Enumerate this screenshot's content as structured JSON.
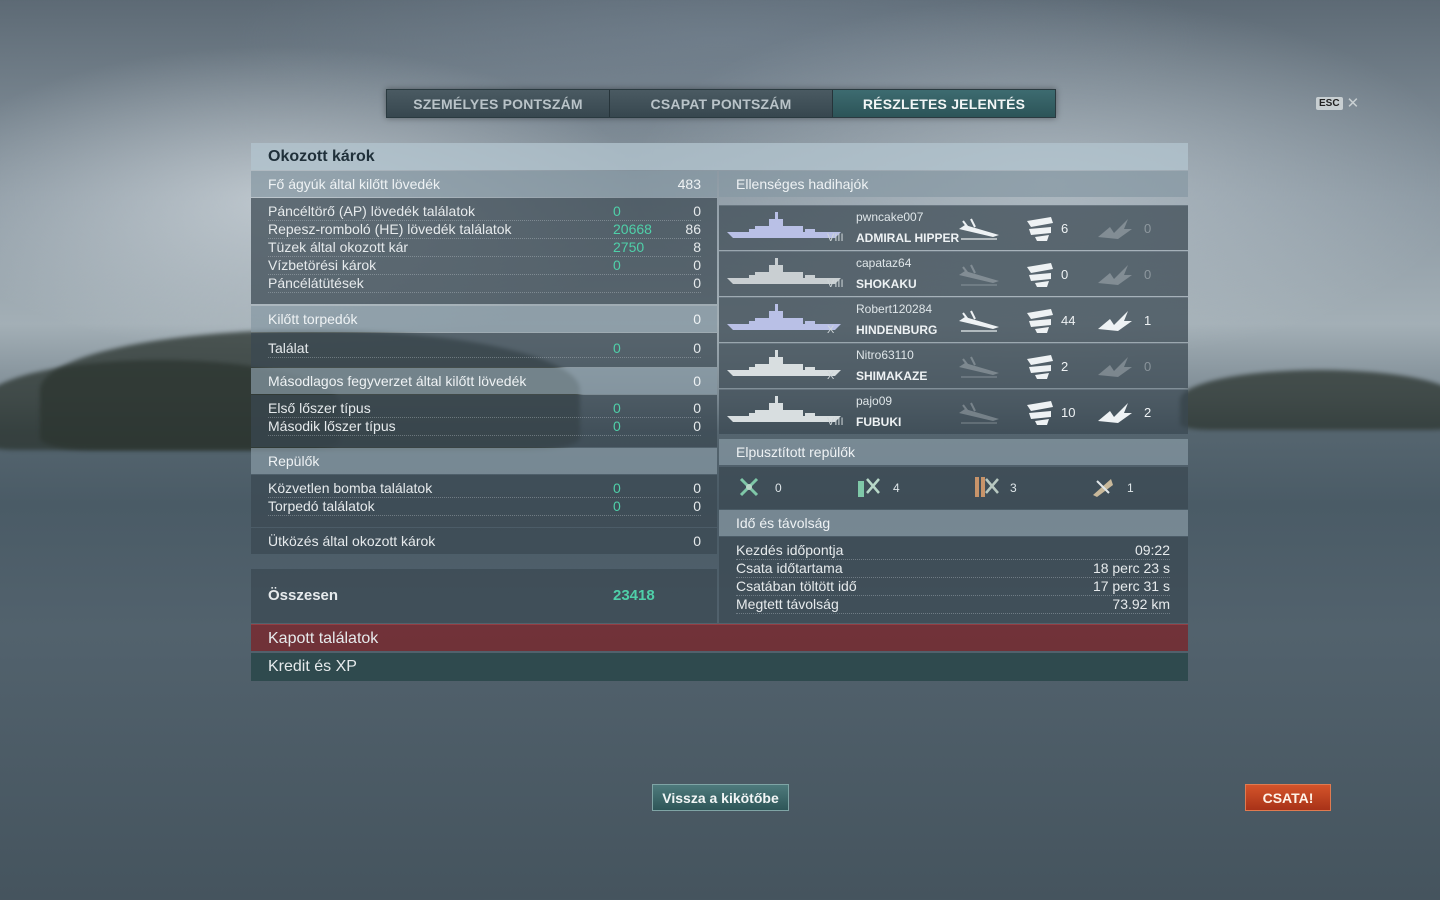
{
  "tabs": [
    {
      "label": "SZEMÉLYES PONTSZÁM",
      "active": false
    },
    {
      "label": "CSAPAT PONTSZÁM",
      "active": false
    },
    {
      "label": "RÉSZLETES JELENTÉS",
      "active": true
    }
  ],
  "esc": {
    "key": "ESC",
    "close": "✕"
  },
  "damage": {
    "title": "Okozott károk",
    "main_guns": {
      "label": "Fő ágyúk által kilőtt lövedék",
      "value": "483"
    },
    "main_rows": [
      {
        "label": "Páncéltörő (AP) lövedék találatok",
        "damage": "0",
        "value": "0"
      },
      {
        "label": "Repesz-romboló (HE) lövedék találatok",
        "damage": "20668",
        "value": "86"
      },
      {
        "label": "Tüzek által okozott kár",
        "damage": "2750",
        "value": "8"
      },
      {
        "label": "Vízbetörési károk",
        "damage": "0",
        "value": "0"
      },
      {
        "label": "Páncélátütések",
        "damage": "",
        "value": "0"
      }
    ],
    "torpedoes": {
      "label": "Kilőtt torpedók",
      "value": "0"
    },
    "torpedo_rows": [
      {
        "label": "Találat",
        "damage": "0",
        "value": "0"
      }
    ],
    "secondary": {
      "label": "Másodlagos fegyverzet által kilőtt lövedék",
      "value": "0"
    },
    "secondary_rows": [
      {
        "label": "Első lőszer típus",
        "damage": "0",
        "value": "0"
      },
      {
        "label": "Második lőszer típus",
        "damage": "0",
        "value": "0"
      }
    ],
    "aircraft": {
      "label": "Repülők"
    },
    "aircraft_rows": [
      {
        "label": "Közvetlen bomba találatok",
        "damage": "0",
        "value": "0"
      },
      {
        "label": "Torpedó találatok",
        "damage": "0",
        "value": "0"
      }
    ],
    "ramming": {
      "label": "Ütközés által okozott károk",
      "value": "0"
    },
    "total": {
      "label": "Összesen",
      "value": "23418"
    }
  },
  "enemies": {
    "title": "Ellenséges hadihajók",
    "ships": [
      {
        "player": "pwncake007",
        "tier": "VIII",
        "name": "ADMIRAL HIPPER",
        "spotted": true,
        "hits": "6",
        "crits": "0",
        "crit_active": false,
        "hull_color": "#b9c0e6"
      },
      {
        "player": "capataz64",
        "tier": "VIII",
        "name": "SHOKAKU",
        "spotted": false,
        "hits": "0",
        "crits": "0",
        "crit_active": false,
        "hull_color": "#c9cfd2"
      },
      {
        "player": "Robert120284",
        "tier": "X",
        "name": "HINDENBURG",
        "spotted": true,
        "hits": "44",
        "crits": "1",
        "crit_active": true,
        "hull_color": "#b9c0e6"
      },
      {
        "player": "Nitro63110",
        "tier": "X",
        "name": "SHIMAKAZE",
        "spotted": false,
        "hits": "2",
        "crits": "0",
        "crit_active": false,
        "hull_color": "#d8dee0"
      },
      {
        "player": "pajo09",
        "tier": "VIII",
        "name": "FUBUKI",
        "spotted": false,
        "hits": "10",
        "crits": "2",
        "crit_active": true,
        "hull_color": "#d8dee0"
      }
    ]
  },
  "planes": {
    "title": "Elpusztított repülők",
    "items": [
      {
        "icon": "fighter-plane-icon",
        "count": "0"
      },
      {
        "icon": "torpedo-bomber-icon",
        "count": "4"
      },
      {
        "icon": "dive-bomber-icon",
        "count": "3"
      },
      {
        "icon": "spotter-plane-icon",
        "count": "1"
      }
    ]
  },
  "time": {
    "title": "Idő és távolság",
    "rows": [
      {
        "label": "Kezdés időpontja",
        "value": "09:22"
      },
      {
        "label": "Csata időtartama",
        "value": "18 perc 23 s"
      },
      {
        "label": "Csatában töltött idő",
        "value": "17 perc 31 s"
      },
      {
        "label": "Megtett távolság",
        "value": "73.92 km"
      }
    ]
  },
  "received": {
    "label": "Kapott találatok"
  },
  "credits": {
    "label": "Kredit és XP"
  },
  "buttons": {
    "back": "Vissza a kikötőbe",
    "battle": "CSATA!"
  },
  "colors": {
    "accent_green": "#4fd0a9",
    "battle_orange": "#c8461f",
    "received_red": "#782830"
  }
}
